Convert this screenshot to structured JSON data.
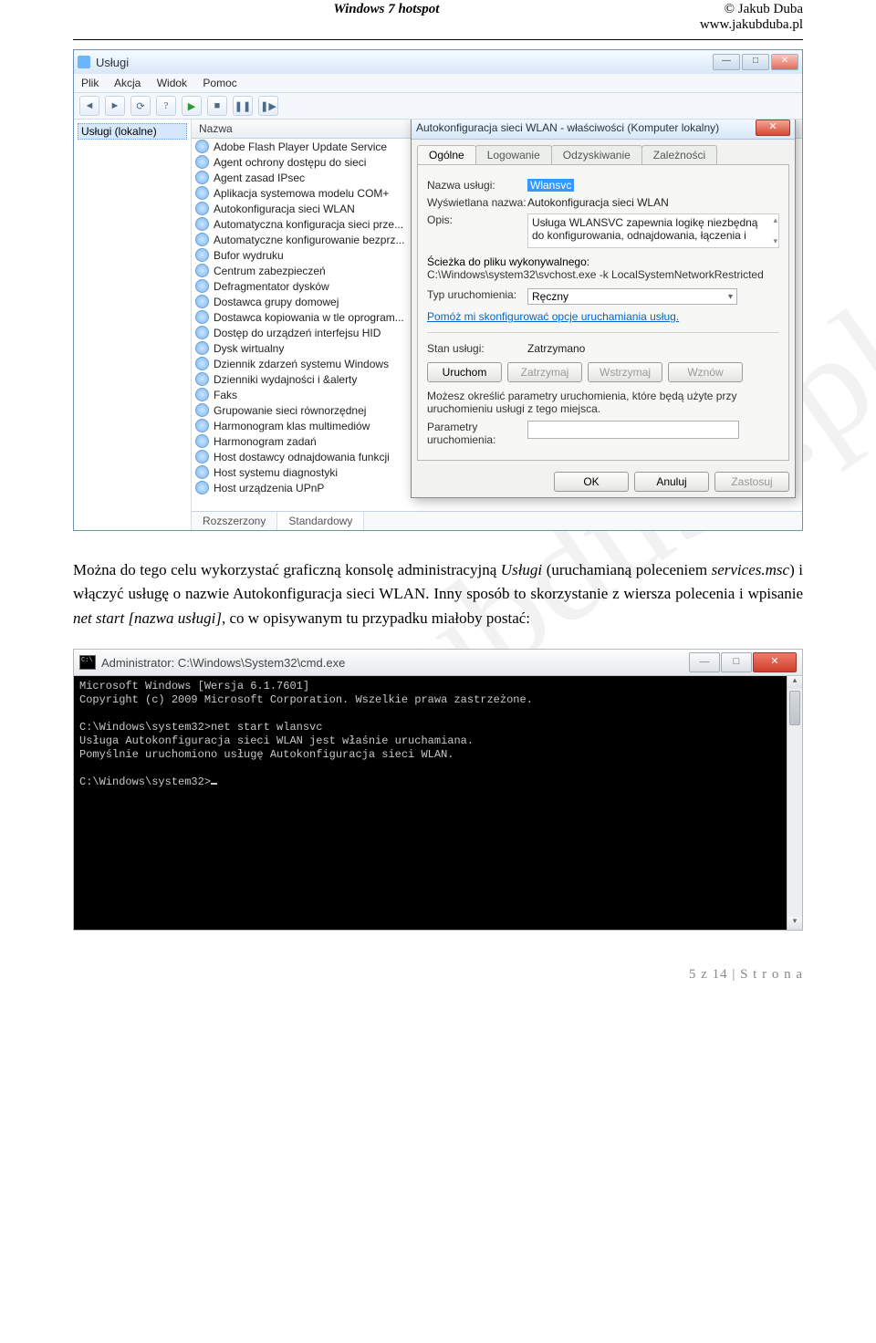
{
  "header": {
    "title": "Windows 7 hotspot",
    "author": "© Jakub Duba",
    "site": "www.jakubduba.pl"
  },
  "watermark": "jakubduba.pl",
  "paragraph": {
    "p1": "Można do tego celu wykorzystać graficzną konsolę administracyjną ",
    "i1": "Usługi",
    "p2": " (uruchamianą poleceniem ",
    "i2": "services.msc",
    "p3": ") i włączyć usługę o nazwie ",
    "b1": "Autokonfiguracja sieci WLAN",
    "p4": ". Inny sposób to skorzystanie z wiersza polecenia i wpisanie ",
    "i3": "net start [nazwa usługi]",
    "p5": ", co w opisywanym tu przypadku miałoby postać:"
  },
  "services_window": {
    "title": "Usługi",
    "menu": [
      "Plik",
      "Akcja",
      "Widok",
      "Pomoc"
    ],
    "tree_root": "Usługi (lokalne)",
    "col_name": "Nazwa",
    "items": [
      "Adobe Flash Player Update Service",
      "Agent ochrony dostępu do sieci",
      "Agent zasad IPsec",
      "Aplikacja systemowa modelu COM+",
      "Autokonfiguracja sieci WLAN",
      "Automatyczna konfiguracja sieci prze...",
      "Automatyczne konfigurowanie bezprz...",
      "Bufor wydruku",
      "Centrum zabezpieczeń",
      "Defragmentator dysków",
      "Dostawca grupy domowej",
      "Dostawca kopiowania w tle oprogram...",
      "Dostęp do urządzeń interfejsu HID",
      "Dysk wirtualny",
      "Dziennik zdarzeń systemu Windows",
      "Dzienniki wydajności i &alerty",
      "Faks",
      "Grupowanie sieci równorzędnej",
      "Harmonogram klas multimediów",
      "Harmonogram zadań",
      "Host dostawcy odnajdowania funkcji",
      "Host systemu diagnostyki",
      "Host urządzenia UPnP"
    ],
    "tabs": {
      "ext": "Rozszerzony",
      "std": "Standardowy"
    }
  },
  "dialog": {
    "title": "Autokonfiguracja sieci WLAN - właściwości (Komputer lokalny)",
    "tabs": [
      "Ogólne",
      "Logowanie",
      "Odzyskiwanie",
      "Zależności"
    ],
    "lab_name": "Nazwa usługi:",
    "val_name": "Wlansvc",
    "lab_disp": "Wyświetlana nazwa:",
    "val_disp": "Autokonfiguracja sieci WLAN",
    "lab_desc": "Opis:",
    "val_desc": "Usługa WLANSVC zapewnia logikę niezbędną do konfigurowania, odnajdowania, łączenia i",
    "lab_path": "Ścieżka do pliku wykonywalnego:",
    "val_path": "C:\\Windows\\system32\\svchost.exe -k LocalSystemNetworkRestricted",
    "lab_start": "Typ uruchomienia:",
    "val_start": "Ręczny",
    "help_link": "Pomóż mi skonfigurować opcje uruchamiania usług.",
    "lab_state": "Stan usługi:",
    "val_state": "Zatrzymano",
    "btn_start": "Uruchom",
    "btn_stop": "Zatrzymaj",
    "btn_pause": "Wstrzymaj",
    "btn_resume": "Wznów",
    "hint": "Możesz określić parametry uruchomienia, które będą użyte przy uruchomieniu usługi z tego miejsca.",
    "lab_param": "Parametry uruchomienia:",
    "ok": "OK",
    "cancel": "Anuluj",
    "apply": "Zastosuj"
  },
  "cmd": {
    "title": "Administrator: C:\\Windows\\System32\\cmd.exe",
    "l1": "Microsoft Windows [Wersja 6.1.7601]",
    "l2": "Copyright (c) 2009 Microsoft Corporation. Wszelkie prawa zastrzeżone.",
    "l3": "C:\\Windows\\system32>net start wlansvc",
    "l4": "Usługa Autokonfiguracja sieci WLAN jest właśnie uruchamiana.",
    "l5": "Pomyślnie uruchomiono usługę Autokonfiguracja sieci WLAN.",
    "l6": "C:\\Windows\\system32>"
  },
  "footer": "5 z 14 | S t r o n a"
}
